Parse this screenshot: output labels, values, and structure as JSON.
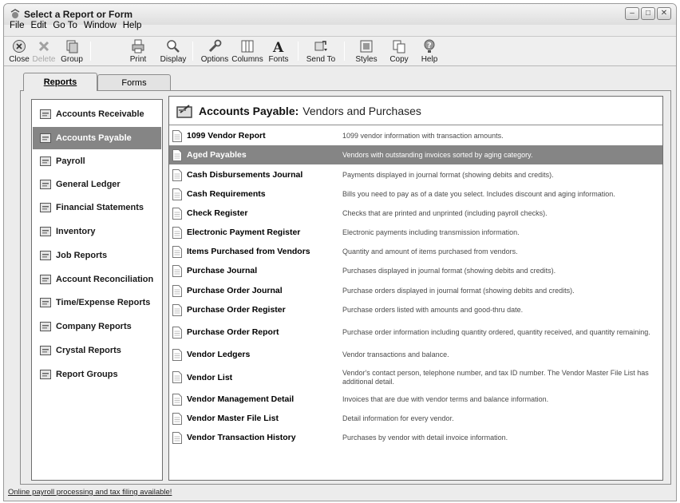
{
  "window": {
    "title": "Select a Report or Form"
  },
  "menu": [
    "File",
    "Edit",
    "Go To",
    "Window",
    "Help"
  ],
  "toolbar": {
    "close": "Close",
    "delete": "Delete",
    "group": "Group",
    "print": "Print",
    "display": "Display",
    "options": "Options",
    "columns": "Columns",
    "fonts": "Fonts",
    "send_to": "Send To",
    "styles": "Styles",
    "copy": "Copy",
    "help": "Help"
  },
  "tabs": {
    "reports": "Reports",
    "forms": "Forms"
  },
  "sidebar": {
    "items": [
      {
        "label": "Accounts Receivable",
        "icon": "accounts-receivable-icon"
      },
      {
        "label": "Accounts Payable",
        "icon": "accounts-payable-icon",
        "selected": true
      },
      {
        "label": "Payroll",
        "icon": "payroll-icon"
      },
      {
        "label": "General Ledger",
        "icon": "general-ledger-icon"
      },
      {
        "label": "Financial Statements",
        "icon": "financial-statements-icon"
      },
      {
        "label": "Inventory",
        "icon": "inventory-icon"
      },
      {
        "label": "Job Reports",
        "icon": "job-reports-icon"
      },
      {
        "label": "Account Reconciliation",
        "icon": "account-reconciliation-icon"
      },
      {
        "label": "Time/Expense Reports",
        "icon": "time-expense-icon"
      },
      {
        "label": "Company Reports",
        "icon": "company-reports-icon"
      },
      {
        "label": "Crystal Reports",
        "icon": "crystal-reports-icon"
      },
      {
        "label": "Report Groups",
        "icon": "report-groups-icon"
      }
    ]
  },
  "content": {
    "title_bold": "Accounts Payable:",
    "title_rest": "Vendors and Purchases",
    "reports": [
      {
        "name": "1099 Vendor Report",
        "desc": "1099 vendor information with transaction amounts."
      },
      {
        "name": "Aged Payables",
        "desc": "Vendors with outstanding invoices sorted by aging category.",
        "selected": true
      },
      {
        "name": "Cash Disbursements Journal",
        "desc": "Payments displayed in journal format (showing debits and credits)."
      },
      {
        "name": "Cash Requirements",
        "desc": "Bills you need to pay as of a date you select. Includes discount and aging information."
      },
      {
        "name": "Check Register",
        "desc": "Checks that are printed and unprinted (including payroll checks)."
      },
      {
        "name": "Electronic Payment Register",
        "desc": "Electronic payments including transmission information."
      },
      {
        "name": "Items Purchased from Vendors",
        "desc": "Quantity and amount of items purchased from vendors."
      },
      {
        "name": "Purchase Journal",
        "desc": "Purchases displayed in journal format (showing debits and credits)."
      },
      {
        "name": "Purchase Order Journal",
        "desc": "Purchase orders displayed in journal format (showing debits and credits)."
      },
      {
        "name": "Purchase Order Register",
        "desc": "Purchase orders listed with amounts and good-thru date."
      },
      {
        "name": "Purchase Order Report",
        "desc": "Purchase order information including quantity ordered, quantity received, and quantity remaining."
      },
      {
        "name": "Vendor Ledgers",
        "desc": "Vendor transactions and balance."
      },
      {
        "name": "Vendor List",
        "desc": "Vendor's contact person, telephone number, and tax ID number. The Vendor Master File List has additional detail."
      },
      {
        "name": "Vendor Management Detail",
        "desc": "Invoices that are due with vendor terms and balance information."
      },
      {
        "name": "Vendor Master File List",
        "desc": "Detail information for every vendor."
      },
      {
        "name": "Vendor Transaction History",
        "desc": "Purchases by vendor with detail invoice information."
      }
    ]
  },
  "status": {
    "link": "Online payroll processing and tax filing available!"
  },
  "colors": {
    "selection": "#858585",
    "window_bg": "#ececec"
  }
}
